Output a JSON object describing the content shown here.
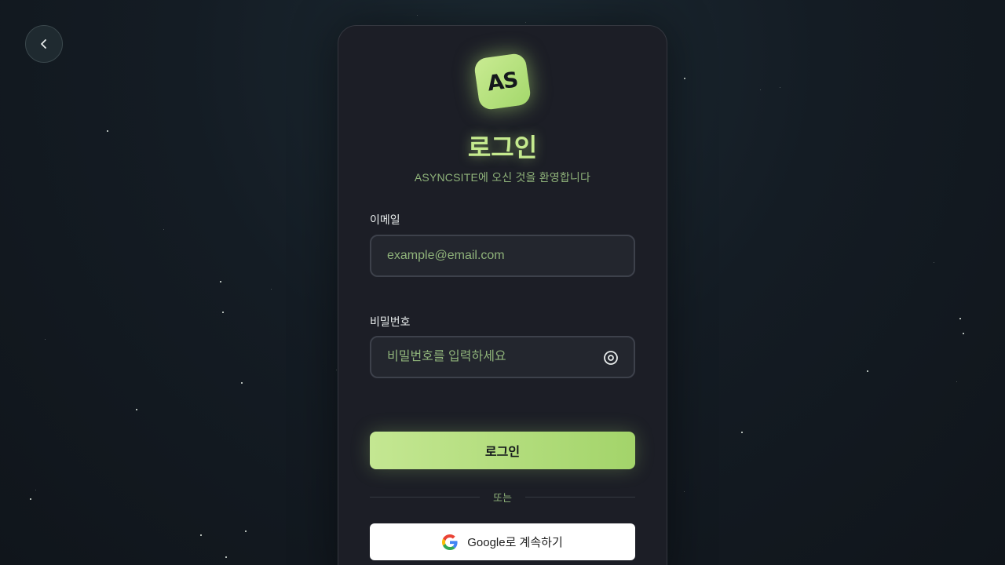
{
  "nav": {
    "back_icon": "chevron-left-icon"
  },
  "brand": {
    "logo_text": "AS",
    "accent_color": "#b8e07f"
  },
  "header": {
    "title": "로그인",
    "subtitle": "ASYNCSITE에 오신 것을 환영합니다"
  },
  "form": {
    "email": {
      "label": "이메일",
      "placeholder": "example@email.com",
      "value": ""
    },
    "password": {
      "label": "비밀번호",
      "placeholder": "비밀번호를 입력하세요",
      "value": "",
      "toggle_icon": "eye-icon"
    },
    "submit_label": "로그인"
  },
  "divider": {
    "text": "또는"
  },
  "social": {
    "google_label": "Google로 계속하기",
    "google_icon": "google-icon"
  }
}
